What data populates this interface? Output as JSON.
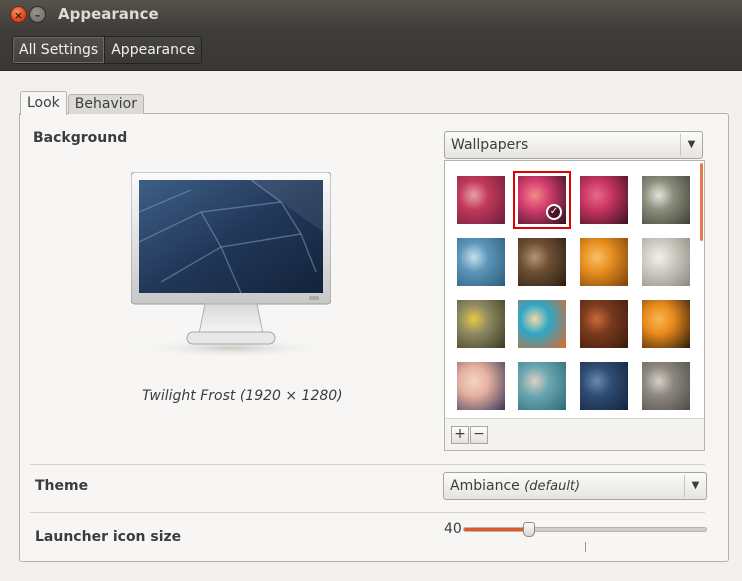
{
  "window": {
    "title": "Appearance",
    "close_glyph": "×",
    "minimize_glyph": "–"
  },
  "toolbar": {
    "breadcrumbs": [
      "All Settings",
      "Appearance"
    ]
  },
  "tabs": [
    {
      "label": "Look",
      "active": true
    },
    {
      "label": "Behavior",
      "active": false
    }
  ],
  "background": {
    "label": "Background",
    "wallpaper_caption": "Twilight Frost (1920 × 1280)",
    "source_dropdown": "Wallpapers",
    "add_label": "+",
    "remove_label": "−",
    "thumbnails": [
      {
        "name": "wallpaper-pink-blur",
        "colors": [
          "#c0395a",
          "#6b1d3c",
          "#e8a0a8"
        ]
      },
      {
        "name": "wallpaper-pink-flower",
        "colors": [
          "#d33d6e",
          "#2e0f1e",
          "#f28a8a"
        ],
        "selected": true
      },
      {
        "name": "wallpaper-pink-flower-2",
        "colors": [
          "#c93562",
          "#3a1020",
          "#e66a8a"
        ]
      },
      {
        "name": "wallpaper-white-flowers",
        "colors": [
          "#8a8e7c",
          "#3c3f36",
          "#e6e3db"
        ]
      },
      {
        "name": "wallpaper-blue-dots",
        "colors": [
          "#5b95b8",
          "#2c5c7c",
          "#c4e0ec"
        ]
      },
      {
        "name": "wallpaper-brown-earth",
        "colors": [
          "#6e5034",
          "#2a1d12",
          "#b69476"
        ]
      },
      {
        "name": "wallpaper-orange-flower",
        "colors": [
          "#e89020",
          "#7a3e0c",
          "#f7c268"
        ]
      },
      {
        "name": "wallpaper-white-clock",
        "colors": [
          "#cfccc4",
          "#8c8880",
          "#f2f0ea"
        ]
      },
      {
        "name": "wallpaper-yellow-flower",
        "colors": [
          "#8e8a62",
          "#3a3a22",
          "#e8c846"
        ]
      },
      {
        "name": "wallpaper-graffiti",
        "colors": [
          "#2fa6c6",
          "#e06a28",
          "#f2d8a8"
        ]
      },
      {
        "name": "wallpaper-brown-insect",
        "colors": [
          "#7a3a1e",
          "#3a1a0c",
          "#c86a3a"
        ]
      },
      {
        "name": "wallpaper-orange-ring",
        "colors": [
          "#e88a1c",
          "#2a1a0e",
          "#f8b650"
        ]
      },
      {
        "name": "wallpaper-sunset-city",
        "colors": [
          "#e6b0a0",
          "#3a3858",
          "#f2d4c4"
        ]
      },
      {
        "name": "wallpaper-teal-blur",
        "colors": [
          "#6aa6b0",
          "#2c6a78",
          "#dcd0c0"
        ]
      },
      {
        "name": "wallpaper-twilight-frost",
        "colors": [
          "#2f4c72",
          "#13233c",
          "#6a88aa"
        ]
      },
      {
        "name": "wallpaper-grey-blur",
        "colors": [
          "#8c8880",
          "#4e4b46",
          "#d6d0c6"
        ]
      }
    ]
  },
  "theme": {
    "label": "Theme",
    "value": "Ambiance",
    "suffix": "(default)"
  },
  "launcher": {
    "label": "Launcher icon size",
    "value": 40,
    "min": 32,
    "max": 64
  },
  "colors": {
    "accent": "#e0592d",
    "selection": "#e00000"
  }
}
